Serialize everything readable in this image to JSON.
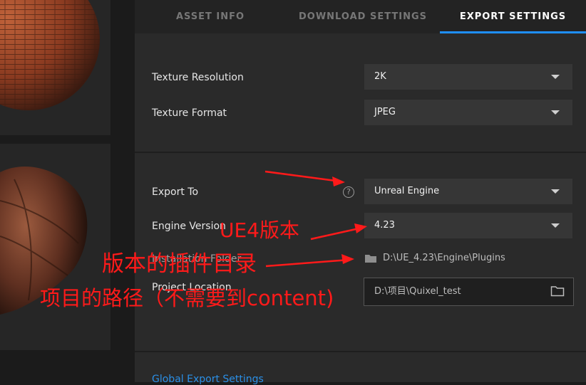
{
  "tabs": [
    {
      "label": "ASSET INFO"
    },
    {
      "label": "DOWNLOAD SETTINGS"
    },
    {
      "label": "EXPORT SETTINGS"
    }
  ],
  "texture": {
    "resolution_label": "Texture Resolution",
    "resolution_value": "2K",
    "format_label": "Texture Format",
    "format_value": "JPEG"
  },
  "export": {
    "export_to_label": "Export To",
    "export_to_value": "Unreal Engine",
    "help_symbol": "?",
    "engine_version_label": "Engine Version",
    "engine_version_value": "4.23",
    "installation_folder_label": "Installation Folder",
    "installation_folder_value": "D:\\UE_4.23\\Engine\\Plugins",
    "project_location_label": "Project Location",
    "project_location_value": "D:\\项目\\Quixel_test"
  },
  "footer": {
    "global_export_label": "Global Export Settings"
  },
  "annotations": {
    "ue4_version": "UE4版本",
    "plugin_dir": "版本的插件目录",
    "project_path": "项目的路径（不需要到content)"
  },
  "colors": {
    "accent": "#1f8fff",
    "annotation": "#ff1a1a",
    "link": "#2a8fe6"
  },
  "icons": [
    "help-icon",
    "chevron-down-icon",
    "folder-icon"
  ]
}
